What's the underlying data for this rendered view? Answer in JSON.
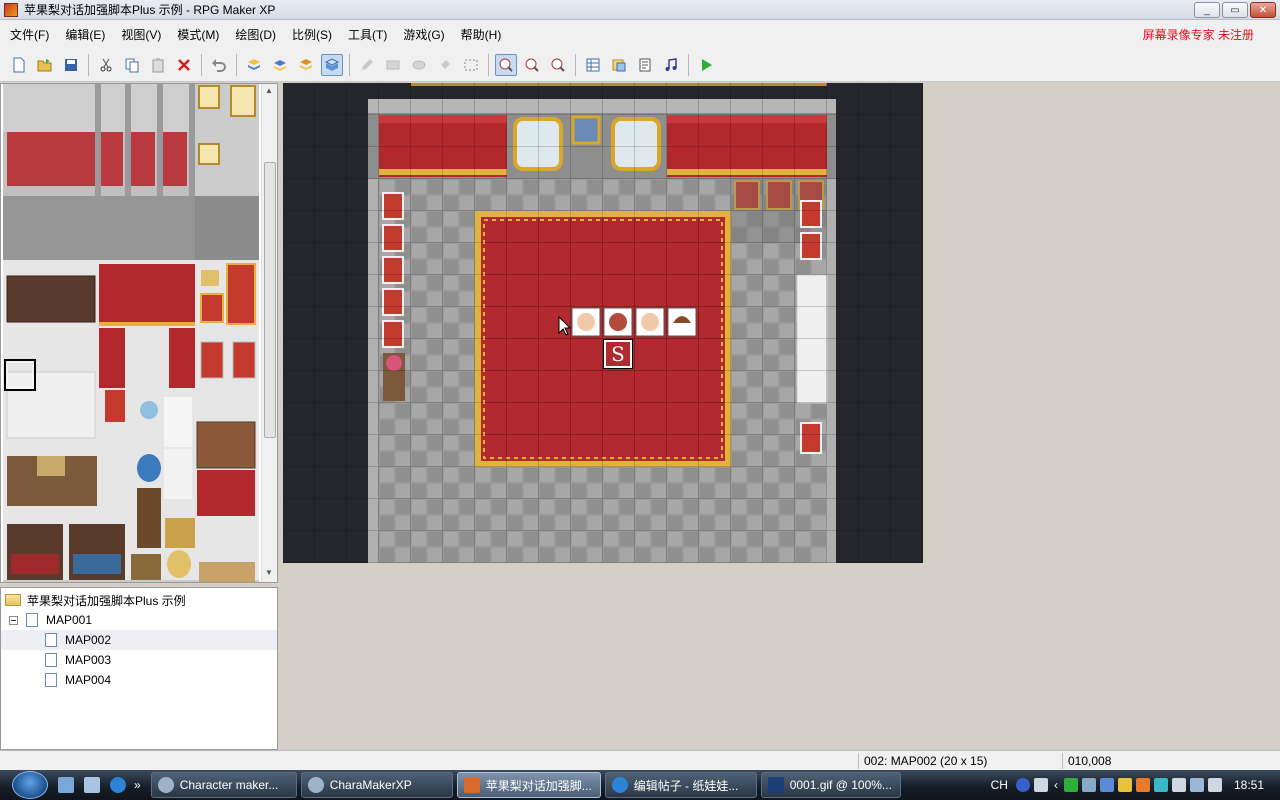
{
  "window": {
    "title": "苹果梨对话加强脚本Plus 示例 - RPG Maker XP",
    "minimize": "_",
    "maximize": "▭",
    "close": "✕"
  },
  "menu": {
    "items": [
      "文件(F)",
      "编辑(E)",
      "视图(V)",
      "模式(M)",
      "绘图(D)",
      "比例(S)",
      "工具(T)",
      "游戏(G)",
      "帮助(H)"
    ],
    "watermark": "屏幕录像专家  未注册"
  },
  "tree": {
    "root": "苹果梨对话加强脚本Plus 示例",
    "maps": [
      "MAP001",
      "MAP002",
      "MAP003",
      "MAP004"
    ],
    "selected": "MAP002"
  },
  "status": {
    "map_info": "002: MAP002 (20 x 15)",
    "coords": "010,008"
  },
  "map": {
    "start_marker": "S"
  },
  "taskbar": {
    "quicklaunch_more": "»",
    "tasks": [
      {
        "label": "Character maker...",
        "icon_color": "#9fb3c8"
      },
      {
        "label": "CharaMakerXP",
        "icon_color": "#9fb3c8"
      },
      {
        "label": "苹果梨对话加强脚...",
        "icon_color": "#d86a2b"
      },
      {
        "label": "编辑帖子 - 纸娃娃...",
        "icon_color": "#2b83d8"
      },
      {
        "label": "0001.gif @ 100%...",
        "icon_color": "#1b3d75"
      }
    ],
    "lang": "CH",
    "clock": "18:51"
  },
  "colors": {
    "carpet": "#b02a30",
    "carpet_border": "#e2b33c",
    "floor": "#9a9a9a",
    "void": "#24262b"
  }
}
